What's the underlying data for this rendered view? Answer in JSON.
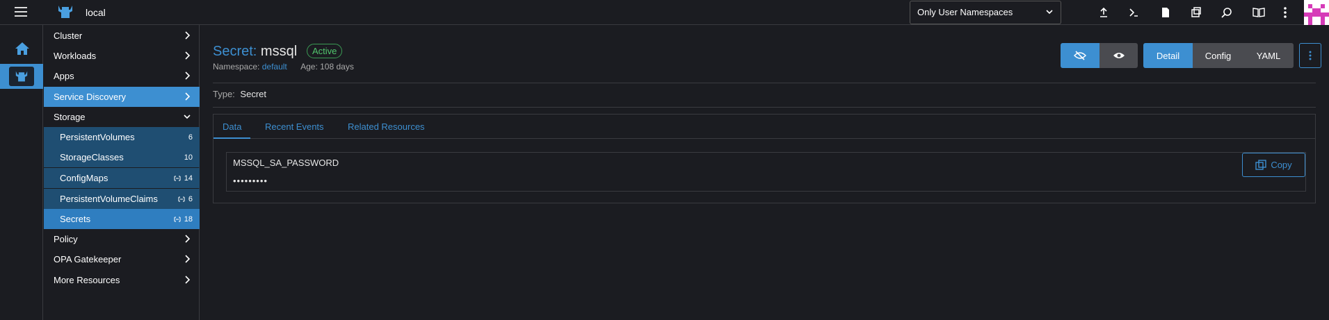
{
  "header": {
    "cluster_name": "local",
    "namespace_filter": "Only User Namespaces",
    "icons": [
      "upload-icon",
      "terminal-icon",
      "file-icon",
      "copy-config-icon",
      "search-icon",
      "book-icon",
      "more-vert-icon"
    ]
  },
  "rail": {
    "home_icon": "home-icon",
    "active_icon": "cluster-icon"
  },
  "sidebar": {
    "groups": [
      {
        "label": "Cluster"
      },
      {
        "label": "Workloads"
      },
      {
        "label": "Apps"
      },
      {
        "label": "Service Discovery"
      },
      {
        "label": "Storage"
      }
    ],
    "storage_items": [
      {
        "label": "PersistentVolumes",
        "count": "6"
      },
      {
        "label": "StorageClasses",
        "count": "10"
      },
      {
        "label": "ConfigMaps",
        "count": "14"
      },
      {
        "label": "PersistentVolumeClaims",
        "count": "6"
      },
      {
        "label": "Secrets",
        "count": "18"
      }
    ],
    "groups_after": [
      {
        "label": "Policy"
      },
      {
        "label": "OPA Gatekeeper"
      },
      {
        "label": "More Resources"
      }
    ]
  },
  "resource": {
    "kind": "Secret:",
    "name": "mssql",
    "state": "Active",
    "namespace_label": "Namespace:",
    "namespace": "default",
    "age_label": "Age:",
    "age": "108 days",
    "type_label": "Type:",
    "type": "Secret"
  },
  "view_modes": {
    "detail": "Detail",
    "config": "Config",
    "yaml": "YAML"
  },
  "tabs": [
    {
      "label": "Data"
    },
    {
      "label": "Recent Events"
    },
    {
      "label": "Related Resources"
    }
  ],
  "data_entries": [
    {
      "key": "MSSQL_SA_PASSWORD",
      "value": "•••••••••"
    }
  ],
  "copy_label": "Copy",
  "colors": {
    "accent": "#3d8fd1",
    "background": "#1b1c21",
    "active_state": "#52c66d"
  }
}
